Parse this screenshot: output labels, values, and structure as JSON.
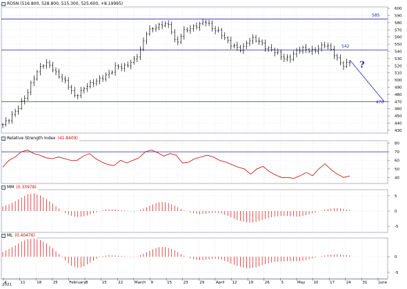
{
  "panels": {
    "price": {
      "symbol": "ROSN",
      "ohlc": "(516.800, 528.800, 515.300, 525.600, +8.19995)"
    },
    "rsi": {
      "name": "Relative Strength Index",
      "value": "(41.8409)"
    },
    "mm": {
      "name": "MM",
      "value": "(0.33978)"
    },
    "ml": {
      "name": "ML",
      "value": "(0.40476)"
    }
  },
  "annotations": {
    "level_585": "585",
    "level_542": "542",
    "level_470": "470",
    "question": "?"
  },
  "colors": {
    "bars": "#000000",
    "rsi_line": "#c00000",
    "osc_bars": "#d40000",
    "hline": "#2323a0",
    "grid": "#b8c0cc",
    "price_bg": "#ffffff",
    "axis_text": "#000000"
  },
  "x_axis": {
    "year": "2021",
    "ticks": [
      "4",
      "11",
      "18",
      "25",
      "February",
      "8",
      "15",
      "22",
      "March",
      "9",
      "15",
      "23",
      "29",
      "April",
      "12",
      "19",
      "26",
      "3",
      "May",
      "10",
      "17",
      "24",
      "31",
      "June"
    ]
  },
  "chart_data": [
    {
      "type": "ohlc",
      "y_ticks": [
        430,
        440,
        450,
        460,
        470,
        480,
        490,
        500,
        510,
        520,
        530,
        540,
        550,
        560,
        570,
        580,
        590,
        600
      ],
      "ylim": [
        426,
        602
      ],
      "hlines": [
        585,
        542,
        470
      ],
      "close_path": [
        438,
        445,
        455,
        467,
        480,
        500,
        515,
        524,
        520,
        508,
        502,
        492,
        477,
        483,
        492,
        496,
        500,
        505,
        510,
        520,
        517,
        522,
        528,
        542,
        566,
        572,
        575,
        579,
        575,
        548,
        567,
        571,
        574,
        578,
        582,
        572,
        568,
        560,
        550,
        546,
        542,
        555,
        558,
        553,
        545,
        542,
        537,
        530,
        530,
        540,
        544,
        542,
        540,
        546,
        550,
        541,
        528,
        520,
        525.6
      ],
      "trend_projection": {
        "from": 528,
        "to": 470
      }
    },
    {
      "type": "line",
      "series": [
        {
          "name": "Relative Strength Index",
          "values": [
            52,
            60,
            64,
            70,
            72,
            68,
            66,
            63,
            62,
            64,
            62,
            60,
            60,
            65,
            68,
            62,
            58,
            55,
            54,
            60,
            57,
            60,
            63,
            70,
            72,
            69,
            65,
            68,
            66,
            57,
            58,
            62,
            64,
            66,
            64,
            60,
            58,
            55,
            52,
            50,
            44,
            50,
            53,
            47,
            43,
            40,
            40,
            39,
            42,
            46,
            42,
            50,
            56,
            49,
            44,
            40,
            41.84
          ]
        }
      ],
      "y_ticks": [
        40,
        50,
        60,
        70,
        80
      ],
      "ylim": [
        33,
        83
      ],
      "hlines": [
        70
      ]
    },
    {
      "type": "bar",
      "name": "MM",
      "values": [
        1.5,
        2.2,
        3.2,
        4.4,
        5.5,
        5.8,
        5.2,
        4.0,
        2.5,
        1.0,
        -0.5,
        -1.5,
        -2.0,
        -1.8,
        -1.2,
        -0.5,
        0.3,
        0.6,
        0.5,
        0.3,
        0.2,
        -0.3,
        0.3,
        1.0,
        2.0,
        2.8,
        3.0,
        2.5,
        1.5,
        0.5,
        -0.3,
        -0.8,
        -1.0,
        -0.8,
        -0.5,
        -0.6,
        -1.3,
        -2.2,
        -3.0,
        -3.6,
        -3.8,
        -3.5,
        -2.8,
        -2.2,
        -1.8,
        -1.6,
        -1.6,
        -1.8,
        -1.8,
        -1.3,
        -0.7,
        -0.1,
        0.4,
        0.8,
        1.0,
        0.7,
        0.34
      ],
      "y_ticks": [
        -5,
        0,
        5
      ],
      "ylim": [
        -7,
        7
      ]
    },
    {
      "type": "bar",
      "name": "ML",
      "values": [
        1.5,
        2.5,
        3.6,
        4.8,
        5.6,
        5.8,
        5.4,
        4.3,
        2.8,
        1.0,
        -1.0,
        -2.8,
        -3.6,
        -3.2,
        -2.0,
        -0.8,
        0.2,
        0.5,
        0.4,
        0.3,
        0.1,
        -0.2,
        0.3,
        1.2,
        2.2,
        3.0,
        3.2,
        2.7,
        1.8,
        0.6,
        -0.3,
        -0.9,
        -1.1,
        -0.9,
        -0.6,
        -0.7,
        -1.4,
        -2.3,
        -3.0,
        -3.6,
        -3.7,
        -3.3,
        -2.6,
        -2.0,
        -1.6,
        -1.5,
        -1.4,
        -1.5,
        -1.4,
        -1.0,
        -0.5,
        0.0,
        0.4,
        0.7,
        0.8,
        0.6,
        0.4
      ],
      "y_ticks": [
        -5,
        0
      ],
      "ylim": [
        -7,
        6
      ]
    }
  ]
}
